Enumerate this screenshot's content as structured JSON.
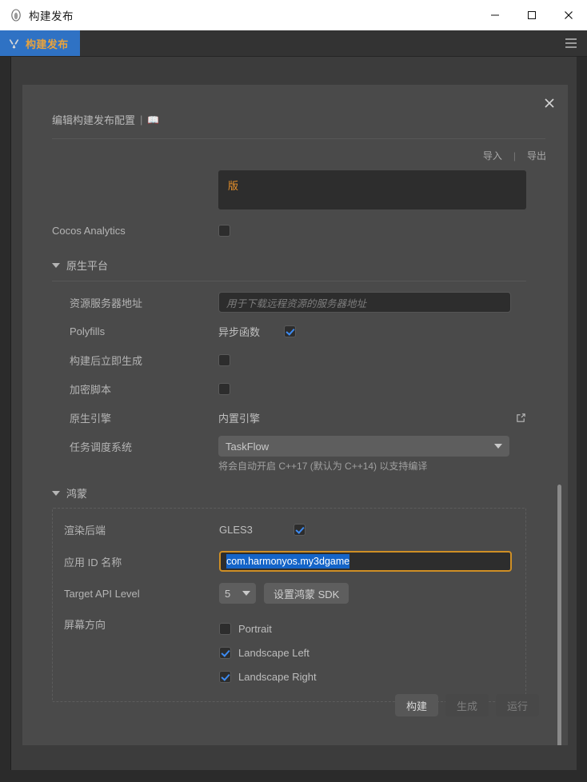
{
  "window": {
    "title": "构建发布",
    "app_icon": "cocos-logo-icon",
    "minimize_label": "–",
    "maximize_label": "□",
    "close_label": "✕"
  },
  "tabbar": {
    "tab_label": "构建发布",
    "tab_icon": "build-tools-icon",
    "menu_icon": "hamburger-menu-icon",
    "accent": "#2f72c4",
    "tab_text_color": "#e8a33d"
  },
  "dialog": {
    "title": "编辑构建发布配置",
    "title_separator": "|",
    "doc_icon": "book-icon",
    "close_icon": "✕",
    "import_label": "导入",
    "io_divider": "|",
    "export_label": "导出",
    "version_value": "版"
  },
  "form": {
    "analytics": {
      "label": "Cocos Analytics",
      "checked": false
    },
    "native_section": {
      "label": "原生平台",
      "expanded": true,
      "rows": {
        "resource_server": {
          "label": "资源服务器地址",
          "value": "",
          "placeholder": "用于下载远程资源的服务器地址"
        },
        "polyfills": {
          "label": "Polyfills",
          "option_label": "异步函数",
          "checked": true
        },
        "build_after": {
          "label": "构建后立即生成",
          "checked": false
        },
        "encrypt_script": {
          "label": "加密脚本",
          "checked": false
        },
        "native_engine": {
          "label": "原生引擎",
          "value": "内置引擎",
          "edit_icon": "external-edit-icon"
        },
        "task_system": {
          "label": "任务调度系统",
          "value": "TaskFlow",
          "hint": "将会自动开启 C++17 (默认为 C++14) 以支持编译"
        }
      }
    },
    "harmony_section": {
      "label": "鸿蒙",
      "expanded": true,
      "rows": {
        "render_backend": {
          "label": "渲染后端",
          "option_label": "GLES3",
          "checked": true
        },
        "app_id": {
          "label": "应用 ID 名称",
          "value": "com.harmonyos.my3dgame",
          "selected": true
        },
        "api_level": {
          "label": "Target API Level",
          "value": "5",
          "sdk_button": "设置鸿蒙 SDK"
        },
        "orientation": {
          "label": "屏幕方向",
          "options": [
            {
              "label": "Portrait",
              "checked": false
            },
            {
              "label": "Landscape Left",
              "checked": true
            },
            {
              "label": "Landscape Right",
              "checked": true
            }
          ]
        }
      }
    }
  },
  "footer": {
    "build_label": "构建",
    "generate_label": "生成",
    "run_label": "运行",
    "generate_disabled": true,
    "run_disabled": true
  }
}
